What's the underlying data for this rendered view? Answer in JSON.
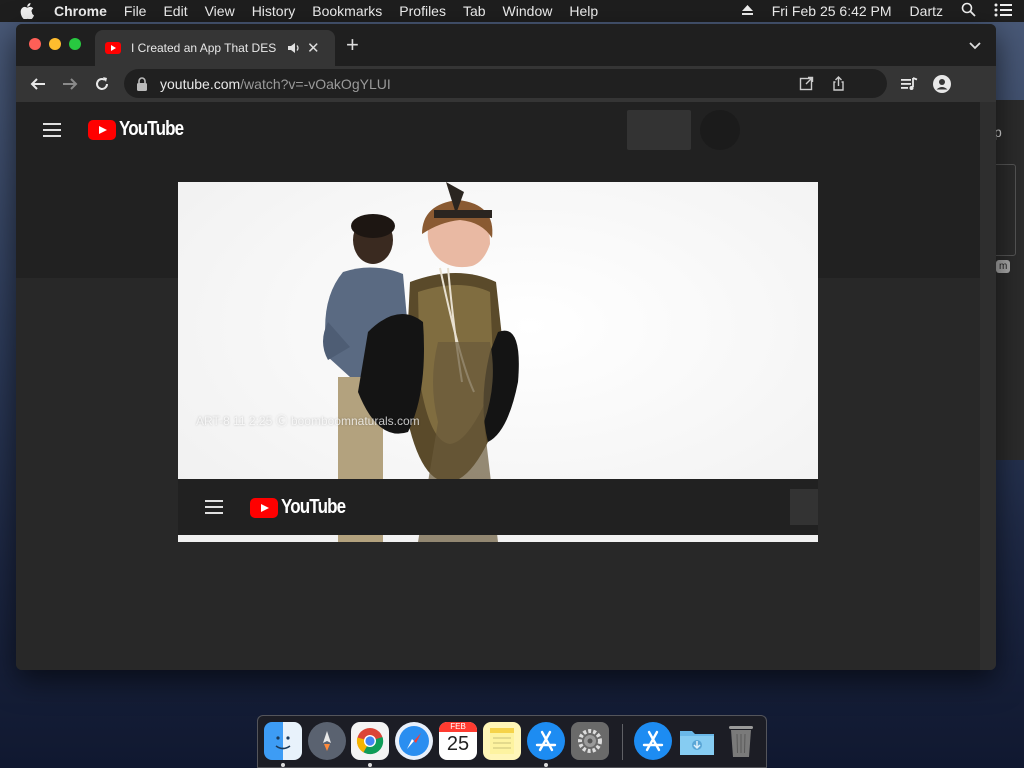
{
  "menubar": {
    "app": "Chrome",
    "items": [
      "File",
      "Edit",
      "View",
      "History",
      "Bookmarks",
      "Profiles",
      "Tab",
      "Window",
      "Help"
    ],
    "datetime": "Fri Feb 25  6:42 PM",
    "user": "Dartz"
  },
  "browser": {
    "tab_title": "I Created an App That DES",
    "url_host": "youtube.com",
    "url_path": "/watch?v=-vOakOgYLUI"
  },
  "youtube": {
    "logo_text": "YouTube",
    "video_watermark": "ART-8 11  2:25 Ⓒ boomboomnaturals.com",
    "inner_logo_text": "YouTube"
  },
  "background_window": {
    "fragment_top": "p",
    "fragment_bottom": "m"
  },
  "dock": {
    "calendar_month": "FEB",
    "calendar_day": "25",
    "icons": [
      "finder-icon",
      "launchpad-icon",
      "chrome-icon",
      "safari-icon",
      "calendar-icon",
      "notes-icon",
      "app-store-icon",
      "system-preferences-icon",
      "app-store-icon",
      "downloads-folder-icon",
      "trash-icon"
    ]
  },
  "colors": {
    "youtube_red": "#ff0000",
    "chrome_toolbar": "#353535",
    "page_background": "#282828"
  }
}
